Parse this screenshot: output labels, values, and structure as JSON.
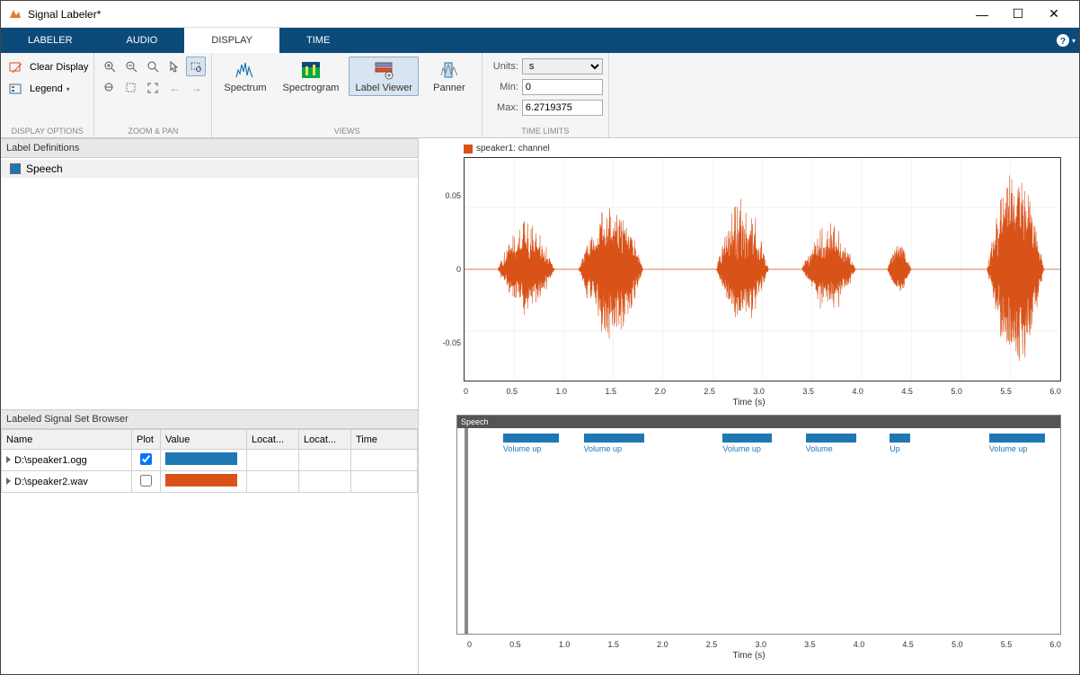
{
  "window": {
    "title": "Signal Labeler*"
  },
  "tabs": {
    "labeler": "LABELER",
    "audio": "AUDIO",
    "display": "DISPLAY",
    "time": "TIME"
  },
  "ribbon": {
    "display_options": {
      "label": "DISPLAY OPTIONS",
      "clear": "Clear Display",
      "legend": "Legend"
    },
    "zoom_pan": {
      "label": "ZOOM & PAN"
    },
    "views": {
      "label": "VIEWS",
      "spectrum": "Spectrum",
      "spectrogram": "Spectrogram",
      "label_viewer": "Label Viewer",
      "panner": "Panner"
    },
    "time_limits": {
      "label": "TIME LIMITS",
      "units_label": "Units:",
      "units_value": "s",
      "min_label": "Min:",
      "min_value": "0",
      "max_label": "Max:",
      "max_value": "6.2719375"
    }
  },
  "panels": {
    "label_defs": {
      "title": "Label Definitions",
      "speech": "Speech",
      "speech_color": "#1f77b4"
    },
    "browser": {
      "title": "Labeled Signal Set Browser",
      "cols": {
        "name": "Name",
        "plot": "Plot",
        "value": "Value",
        "location": "Locat...",
        "location2": "Locat...",
        "time": "Time"
      },
      "rows": [
        {
          "name": "D:\\speaker1.ogg",
          "checked": true,
          "color": "#1f77b4"
        },
        {
          "name": "D:\\speaker2.wav",
          "checked": false,
          "color": "#d95319"
        }
      ]
    }
  },
  "plot": {
    "legend": "speaker1: channel",
    "xlabel": "Time (s)",
    "xticks": [
      "0",
      "0.5",
      "1.0",
      "1.5",
      "2.0",
      "2.5",
      "3.0",
      "3.5",
      "4.0",
      "4.5",
      "5.0",
      "5.5",
      "6.0"
    ],
    "yticks": [
      "0.05",
      "0",
      "-0.05"
    ]
  },
  "labelviewer": {
    "header": "Speech",
    "xlabel": "Time (s)",
    "xticks": [
      "0",
      "0.5",
      "1.0",
      "1.5",
      "2.0",
      "2.5",
      "3.0",
      "3.5",
      "4.0",
      "4.5",
      "5.0",
      "5.5",
      "6.0"
    ],
    "segments": [
      {
        "start_pct": 5.9,
        "width_pct": 9.4,
        "label": "Volume up"
      },
      {
        "start_pct": 19.5,
        "width_pct": 10.3,
        "label": "Volume up"
      },
      {
        "start_pct": 43.0,
        "width_pct": 8.3,
        "label": "Volume up"
      },
      {
        "start_pct": 57.0,
        "width_pct": 8.6,
        "label": "Volume"
      },
      {
        "start_pct": 71.2,
        "width_pct": 3.5,
        "label": "Up"
      },
      {
        "start_pct": 88.0,
        "width_pct": 9.4,
        "label": "Volume up"
      }
    ]
  },
  "chart_data": {
    "type": "line",
    "title": "speaker1: channel",
    "xlabel": "Time (s)",
    "ylabel": "",
    "xlim": [
      0,
      6.27
    ],
    "ylim": [
      -0.09,
      0.09
    ],
    "series": [
      {
        "name": "speaker1: channel",
        "color": "#d95319",
        "envelope_segments": [
          {
            "start": 0.35,
            "end": 0.95,
            "peak_pos": 0.04,
            "peak_neg": -0.03
          },
          {
            "start": 1.2,
            "end": 1.88,
            "peak_pos": 0.05,
            "peak_neg": -0.06
          },
          {
            "start": 2.65,
            "end": 3.2,
            "peak_pos": 0.06,
            "peak_neg": -0.035
          },
          {
            "start": 3.55,
            "end": 4.12,
            "peak_pos": 0.038,
            "peak_neg": -0.025
          },
          {
            "start": 4.45,
            "end": 4.7,
            "peak_pos": 0.02,
            "peak_neg": -0.015
          },
          {
            "start": 5.5,
            "end": 6.1,
            "peak_pos": 0.085,
            "peak_neg": -0.085
          }
        ]
      }
    ],
    "label_track": {
      "name": "Speech",
      "regions": [
        {
          "start": 0.37,
          "end": 0.96,
          "label": "Volume up"
        },
        {
          "start": 1.22,
          "end": 1.87,
          "label": "Volume up"
        },
        {
          "start": 2.7,
          "end": 3.22,
          "label": "Volume up"
        },
        {
          "start": 3.57,
          "end": 4.11,
          "label": "Volume"
        },
        {
          "start": 4.46,
          "end": 4.68,
          "label": "Up"
        },
        {
          "start": 5.52,
          "end": 6.11,
          "label": "Volume up"
        }
      ]
    }
  }
}
